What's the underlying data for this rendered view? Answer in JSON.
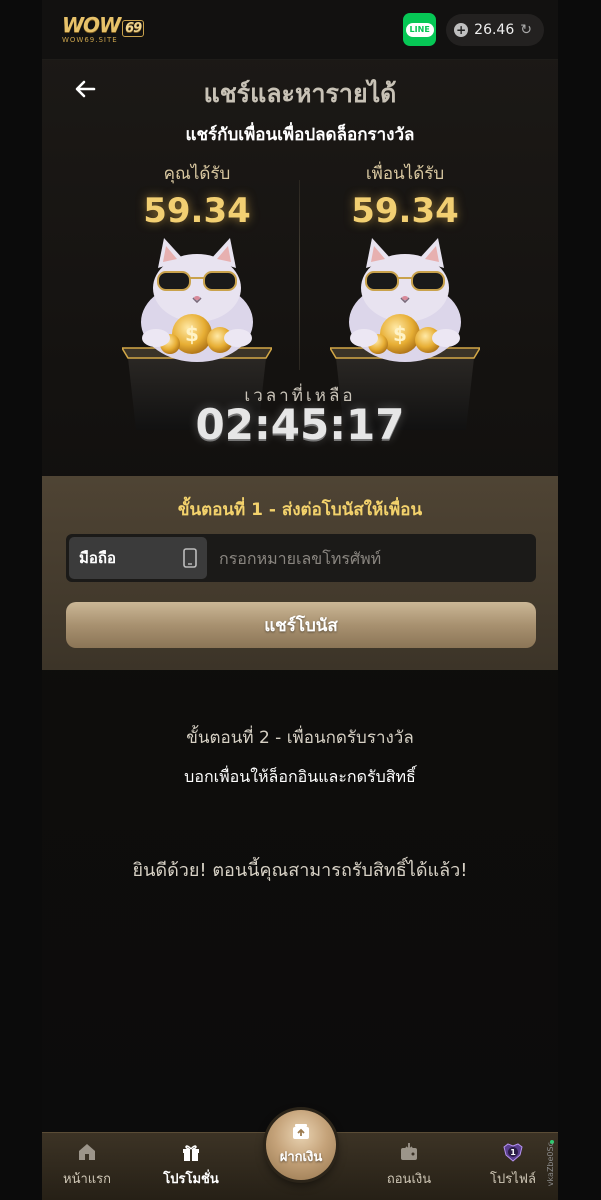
{
  "topbar": {
    "logo_main": "WOW",
    "logo_num": "69",
    "logo_sub": "WOW69.SITE",
    "line_label": "LINE",
    "balance": "26.46",
    "balance_plus": "+",
    "refresh_glyph": "↻"
  },
  "header": {
    "title": "แชร์และหารายได้",
    "subtitle": "แชร์กับเพื่อนเพื่อปลดล็อกรางวัล"
  },
  "rewards": {
    "you_label": "คุณได้รับ",
    "you_amount": "59.34",
    "friend_label": "เพื่อนได้รับ",
    "friend_amount": "59.34"
  },
  "timer": {
    "label": "เวลาที่เหลือ",
    "value": "02:45:17"
  },
  "step1": {
    "title": "ขั้นตอนที่ 1 - ส่งต่อโบนัสให้เพื่อน",
    "phone_type": "มือถือ",
    "phone_placeholder": "กรอกหมายเลขโทรศัพท์",
    "share_button": "แชร์โบนัส"
  },
  "step2": {
    "title": "ขั้นตอนที่ 2 - เพื่อนกดรับรางวัล",
    "desc": "บอกเพื่อนให้ล็อกอินและกดรับสิทธิ์"
  },
  "congrats": "ยินดีด้วย! ตอนนี้คุณสามารถรับสิทธิ์ได้แล้ว!",
  "bottomnav": {
    "home": "หน้าแรก",
    "promo": "โปรโมชั่น",
    "deposit": "ฝากเงิน",
    "withdraw": "ถอนเงิน",
    "profile": "โปรไฟล์",
    "profile_level": "1"
  },
  "side_tag": "vkaZbe0Sc",
  "colors": {
    "accent_gold": "#f2cf72",
    "line_green": "#06c755",
    "panel": "#4f4434"
  },
  "icons": [
    "back-arrow-icon",
    "line-icon",
    "plus-icon",
    "refresh-icon",
    "phone-icon",
    "home-icon",
    "gift-icon",
    "deposit-icon",
    "wallet-icon",
    "profile-badge-icon"
  ]
}
